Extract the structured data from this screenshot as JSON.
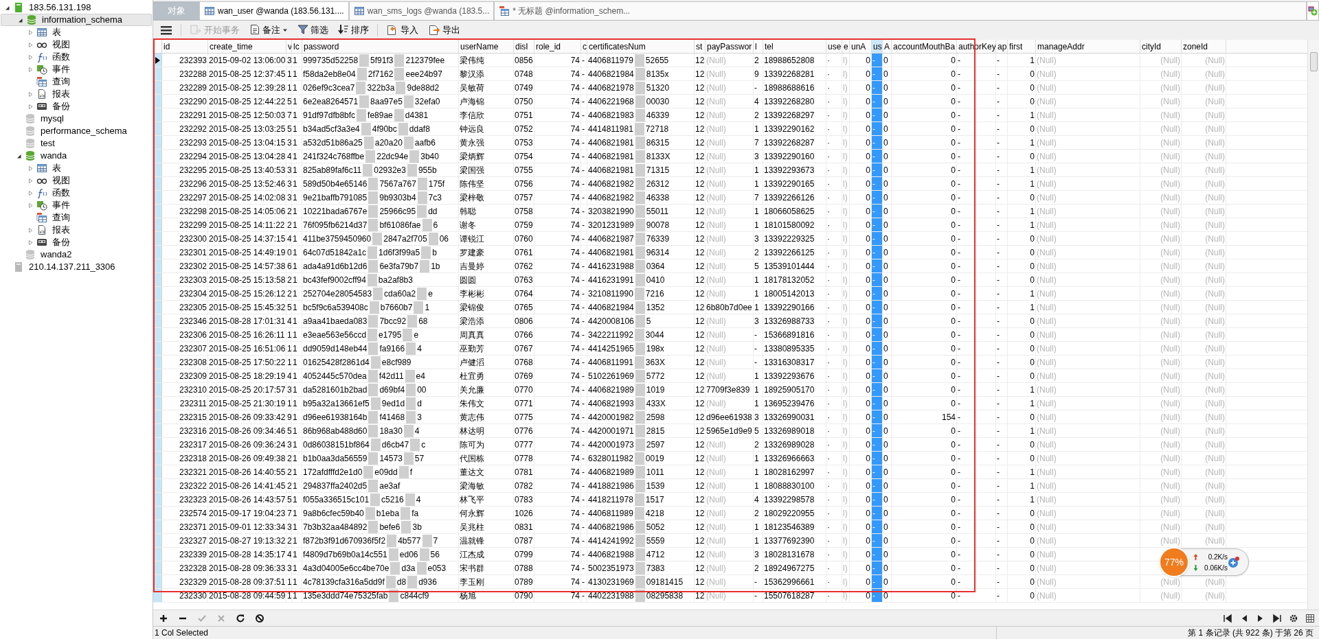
{
  "tree": [
    {
      "label": "183.56.131.198",
      "kind": "server",
      "expanded": true,
      "selected": false,
      "children": [
        {
          "label": "information_schema",
          "kind": "db",
          "expanded": true,
          "selected": true,
          "children": [
            {
              "label": "表",
              "kind": "tables",
              "expanded": false,
              "selected": false
            },
            {
              "label": "视图",
              "kind": "views",
              "expanded": false,
              "selected": false
            },
            {
              "label": "函数",
              "kind": "functions",
              "expanded": false,
              "selected": false
            },
            {
              "label": "事件",
              "kind": "events",
              "expanded": false,
              "selected": false
            },
            {
              "label": "查询",
              "kind": "queries",
              "selected": false
            },
            {
              "label": "报表",
              "kind": "reports",
              "expanded": false,
              "selected": false
            },
            {
              "label": "备份",
              "kind": "backups",
              "expanded": false,
              "selected": false
            }
          ]
        },
        {
          "label": "mysql",
          "kind": "db_off",
          "selected": false
        },
        {
          "label": "performance_schema",
          "kind": "db_off",
          "selected": false
        },
        {
          "label": "test",
          "kind": "db_off",
          "selected": false
        },
        {
          "label": "wanda",
          "kind": "db",
          "expanded": true,
          "selected": false,
          "children": [
            {
              "label": "表",
              "kind": "tables",
              "expanded": false,
              "selected": false
            },
            {
              "label": "视图",
              "kind": "views",
              "expanded": false,
              "selected": false
            },
            {
              "label": "函数",
              "kind": "functions",
              "expanded": false,
              "selected": false
            },
            {
              "label": "事件",
              "kind": "events",
              "expanded": false,
              "selected": false
            },
            {
              "label": "查询",
              "kind": "queries",
              "selected": false
            },
            {
              "label": "报表",
              "kind": "reports",
              "expanded": false,
              "selected": false
            },
            {
              "label": "备份",
              "kind": "backups",
              "expanded": false,
              "selected": false
            }
          ]
        },
        {
          "label": "wanda2",
          "kind": "db_off",
          "selected": false
        }
      ]
    },
    {
      "label": "210.14.137.211_3306",
      "kind": "server_off",
      "selected": false
    }
  ],
  "tabs": [
    {
      "label": "对象",
      "kind": "objects",
      "selected": false
    },
    {
      "label": "wan_user @wanda (183.56.131....",
      "kind": "table",
      "selected": true
    },
    {
      "label": "wan_sms_logs @wanda (183.5...",
      "kind": "table",
      "selected": false
    },
    {
      "label": "* 无标题 @information_schem...",
      "kind": "query",
      "selected": false
    }
  ],
  "toolbar": [
    {
      "kind": "menu",
      "disabled": false,
      "has_menu": false
    },
    {
      "label": "开始事务",
      "kind": "transaction",
      "disabled": true,
      "has_menu": false
    },
    {
      "label": "备注",
      "kind": "note",
      "disabled": false,
      "has_menu": true
    },
    {
      "label": "筛选",
      "kind": "filter",
      "disabled": false,
      "has_menu": false
    },
    {
      "label": "排序",
      "kind": "sort",
      "disabled": false,
      "has_menu": false
    },
    {
      "label": "导入",
      "kind": "import",
      "disabled": false,
      "has_menu": false
    },
    {
      "label": "导出",
      "kind": "export",
      "disabled": false,
      "has_menu": false
    }
  ],
  "table": {
    "columns": [
      {
        "label": "id",
        "selected": false,
        "muted": false
      },
      {
        "label": "create_time",
        "selected": false,
        "muted": false
      },
      {
        "label": "v",
        "selected": false,
        "muted": false
      },
      {
        "label": "lc",
        "selected": false,
        "muted": false
      },
      {
        "label": "password",
        "selected": false,
        "muted": false
      },
      {
        "label": "userName",
        "selected": false,
        "muted": false
      },
      {
        "label": "disI",
        "selected": false,
        "muted": false
      },
      {
        "label": "role_id",
        "selected": false,
        "muted": false
      },
      {
        "label": "c",
        "selected": false,
        "muted": false
      },
      {
        "label": "certificatesNum",
        "selected": false,
        "muted": false
      },
      {
        "label": "st",
        "selected": false,
        "muted": false
      },
      {
        "label": "payPasswor",
        "selected": false,
        "muted": false
      },
      {
        "label": "l",
        "selected": false,
        "muted": false
      },
      {
        "label": "tel",
        "selected": false,
        "muted": false
      },
      {
        "label": "use",
        "selected": false,
        "muted": false
      },
      {
        "label": "e",
        "selected": false,
        "muted": true
      },
      {
        "label": "unA",
        "selected": false,
        "muted": false
      },
      {
        "label": "us",
        "selected": true,
        "muted": false
      },
      {
        "label": "A",
        "selected": false,
        "muted": false
      },
      {
        "label": "accountMouthBa",
        "selected": false,
        "muted": false
      },
      {
        "label": "authorKey",
        "selected": false,
        "muted": false
      },
      {
        "label": "ap",
        "selected": false,
        "muted": false
      },
      {
        "label": "first",
        "selected": false,
        "muted": false
      },
      {
        "label": "manageAddr",
        "selected": false,
        "muted": true
      },
      {
        "label": "cityId",
        "selected": false,
        "muted": true
      },
      {
        "label": "zoneId",
        "selected": false,
        "muted": true
      }
    ],
    "rows": [
      {
        "current": true,
        "pay_null": true,
        "cells": [
          "232393",
          "2015-09-02 13:06:00",
          "3",
          "1",
          [
            "999735d52258",
            "5f91f3",
            "212379fee"
          ],
          "梁伟纯",
          "0856",
          "74",
          "-",
          [
            "4406811979",
            "52655"
          ],
          "12",
          "(Null)",
          "2",
          "18988652808",
          "·",
          "l)",
          "0",
          "-",
          "0",
          "0",
          "-",
          "-",
          "1",
          "(Null)",
          "(Null)",
          "(Null)"
        ]
      },
      {
        "current": false,
        "pay_null": true,
        "cells": [
          "232288",
          "2015-08-25 12:37:45",
          "1",
          "1",
          [
            "f58da2eb8e04",
            "2f7162",
            "eee24b97"
          ],
          "黎汉添",
          "0748",
          "74",
          "-",
          [
            "4406821984",
            "8135x"
          ],
          "12",
          "(Null)",
          "9",
          "13392268281",
          "·",
          "l)",
          "0",
          "-",
          "0",
          "0",
          "-",
          "-",
          "0",
          "(Null)",
          "(Null)",
          "(Null)"
        ]
      },
      {
        "current": false,
        "pay_null": true,
        "cells": [
          "232289",
          "2015-08-25 12:39:28",
          "1",
          "1",
          [
            "026ef9c3cea7",
            "322b3a",
            "9de88d2"
          ],
          "吴敏荷",
          "0749",
          "74",
          "-",
          [
            "4406821978",
            "51320"
          ],
          "12",
          "(Null)",
          "-",
          "18988688616",
          "·",
          "l)",
          "0",
          "-",
          "0",
          "0",
          "-",
          "-",
          "0",
          "(Null)",
          "(Null)",
          "(Null)"
        ]
      },
      {
        "current": false,
        "pay_null": true,
        "cells": [
          "232290",
          "2015-08-25 12:44:22",
          "5",
          "1",
          [
            "6e2ea8264571",
            "8aa97e5",
            "32efa0"
          ],
          "卢海锦",
          "0750",
          "74",
          "-",
          [
            "4406221968",
            "00030"
          ],
          "12",
          "(Null)",
          "4",
          "13392268280",
          "·",
          "l)",
          "0",
          "-",
          "0",
          "0",
          "-",
          "-",
          "0",
          "(Null)",
          "(Null)",
          "(Null)"
        ]
      },
      {
        "current": false,
        "pay_null": true,
        "cells": [
          "232291",
          "2015-08-25 12:50:03",
          "7",
          "1",
          [
            "91df97dfb8bfc",
            "fe89ae",
            "d4381"
          ],
          "李信欣",
          "0751",
          "74",
          "-",
          [
            "4406821983",
            "46339"
          ],
          "12",
          "(Null)",
          "2",
          "13392268297",
          "·",
          "l)",
          "0",
          "-",
          "0",
          "0",
          "-",
          "-",
          "1",
          "(Null)",
          "(Null)",
          "(Null)"
        ]
      },
      {
        "current": false,
        "pay_null": true,
        "cells": [
          "232292",
          "2015-08-25 13:03:25",
          "5",
          "1",
          [
            "b34ad5cf3a3e4",
            "4f90bc",
            "ddaf8"
          ],
          "钟远良",
          "0752",
          "74",
          "-",
          [
            "4414811981",
            "72718"
          ],
          "12",
          "(Null)",
          "1",
          "13392290162",
          "·",
          "l)",
          "0",
          "-",
          "0",
          "0",
          "-",
          "-",
          "0",
          "(Null)",
          "(Null)",
          "(Null)"
        ]
      },
      {
        "current": false,
        "pay_null": true,
        "cells": [
          "232293",
          "2015-08-25 13:04:15",
          "3",
          "1",
          [
            "a532d51b86a25",
            "a20a20",
            "aafb6"
          ],
          "黄永强",
          "0753",
          "74",
          "-",
          [
            "4406821981",
            "86315"
          ],
          "12",
          "(Null)",
          "7",
          "13392268287",
          "·",
          "l)",
          "0",
          "-",
          "0",
          "0",
          "-",
          "-",
          "1",
          "(Null)",
          "(Null)",
          "(Null)"
        ]
      },
      {
        "current": false,
        "pay_null": true,
        "cells": [
          "232294",
          "2015-08-25 13:04:28",
          "4",
          "1",
          [
            "241f324c768ffbe",
            "22dc94e",
            "3b40"
          ],
          "梁炳辉",
          "0754",
          "74",
          "-",
          [
            "4406821981",
            "8133X"
          ],
          "12",
          "(Null)",
          "3",
          "13392290160",
          "·",
          "l)",
          "0",
          "-",
          "0",
          "0",
          "-",
          "-",
          "0",
          "(Null)",
          "(Null)",
          "(Null)"
        ]
      },
      {
        "current": false,
        "pay_null": true,
        "cells": [
          "232295",
          "2015-08-25 13:40:53",
          "3",
          "1",
          [
            "825ab89faf6c11",
            "02932e3",
            "955b"
          ],
          "梁国强",
          "0755",
          "74",
          "-",
          [
            "4406821981",
            "71315"
          ],
          "12",
          "(Null)",
          "1",
          "13392293673",
          "·",
          "l)",
          "0",
          "-",
          "0",
          "0",
          "-",
          "-",
          "1",
          "(Null)",
          "(Null)",
          "(Null)"
        ]
      },
      {
        "current": false,
        "pay_null": true,
        "cells": [
          "232296",
          "2015-08-25 13:52:46",
          "3",
          "1",
          [
            "589d50b4e65146",
            "7567a767",
            "175f"
          ],
          "陈伟坚",
          "0756",
          "74",
          "-",
          [
            "4406821982",
            "26312"
          ],
          "12",
          "(Null)",
          "1",
          "13392290165",
          "·",
          "l)",
          "0",
          "-",
          "0",
          "0",
          "-",
          "-",
          "1",
          "(Null)",
          "(Null)",
          "(Null)"
        ]
      },
      {
        "current": false,
        "pay_null": true,
        "cells": [
          "232297",
          "2015-08-25 14:02:08",
          "3",
          "1",
          [
            "9e21baffb791085",
            "9b9303b4",
            "7c3"
          ],
          "梁梓敬",
          "0757",
          "74",
          "-",
          [
            "4406821982",
            "46338"
          ],
          "12",
          "(Null)",
          "7",
          "13392266126",
          "·",
          "l)",
          "0",
          "-",
          "0",
          "0",
          "-",
          "-",
          "0",
          "(Null)",
          "(Null)",
          "(Null)"
        ]
      },
      {
        "current": false,
        "pay_null": true,
        "cells": [
          "232298",
          "2015-08-25 14:05:06",
          "2",
          "1",
          [
            "10221bada6767e",
            "25966c95",
            "dd"
          ],
          "韩聪",
          "0758",
          "74",
          "-",
          [
            "3203821990",
            "55011"
          ],
          "12",
          "(Null)",
          "1",
          "18066058625",
          "·",
          "l)",
          "0",
          "-",
          "0",
          "0",
          "-",
          "-",
          "1",
          "(Null)",
          "(Null)",
          "(Null)"
        ]
      },
      {
        "current": false,
        "pay_null": true,
        "cells": [
          "232299",
          "2015-08-25 14:11:22",
          "2",
          "1",
          [
            "76f095fb6214d37",
            "bf61086fae",
            "6"
          ],
          "谢冬",
          "0759",
          "74",
          "-",
          [
            "3201231989",
            "90078"
          ],
          "12",
          "(Null)",
          "1",
          "18101580092",
          "·",
          "l)",
          "0",
          "-",
          "0",
          "0",
          "-",
          "-",
          "1",
          "(Null)",
          "(Null)",
          "(Null)"
        ]
      },
      {
        "current": false,
        "pay_null": true,
        "cells": [
          "232300",
          "2015-08-25 14:37:15",
          "4",
          "1",
          [
            "411be3759450960",
            "2847a2f705",
            "06"
          ],
          "谭锐江",
          "0760",
          "74",
          "-",
          [
            "4406821987",
            "76339"
          ],
          "12",
          "(Null)",
          "3",
          "13392229325",
          "·",
          "l)",
          "0",
          "-",
          "0",
          "0",
          "-",
          "-",
          "0",
          "(Null)",
          "(Null)",
          "(Null)"
        ]
      },
      {
        "current": false,
        "pay_null": true,
        "cells": [
          "232301",
          "2015-08-25 14:49:19",
          "0",
          "1",
          [
            "64c07d51842a1c",
            "1d6f3f99a5",
            "b"
          ],
          "罗建豪",
          "0761",
          "74",
          "-",
          [
            "4406821981",
            "96314"
          ],
          "12",
          "(Null)",
          "2",
          "13392266125",
          "·",
          "l)",
          "0",
          "-",
          "0",
          "0",
          "-",
          "-",
          "0",
          "(Null)",
          "(Null)",
          "(Null)"
        ]
      },
      {
        "current": false,
        "pay_null": true,
        "cells": [
          "232302",
          "2015-08-25 14:57:38",
          "6",
          "1",
          [
            "ada4a91d6b12d6",
            "6e3fa79b7",
            "1b"
          ],
          "吉曼婷",
          "0762",
          "74",
          "-",
          [
            "4416231988",
            "0364"
          ],
          "12",
          "(Null)",
          "5",
          "13539101444",
          "·",
          "l)",
          "0",
          "-",
          "0",
          "0",
          "-",
          "-",
          "0",
          "(Null)",
          "(Null)",
          "(Null)"
        ]
      },
      {
        "current": false,
        "pay_null": true,
        "cells": [
          "232303",
          "2015-08-25 15:13:58",
          "2",
          "1",
          [
            "bc43fef9002cff94",
            "ba2af8b3"
          ],
          "圆圆",
          "0763",
          "74",
          "-",
          [
            "4416231991",
            "0410"
          ],
          "12",
          "(Null)",
          "1",
          "18178132052",
          "·",
          "l)",
          "0",
          "-",
          "0",
          "0",
          "-",
          "-",
          "0",
          "(Null)",
          "(Null)",
          "(Null)"
        ]
      },
      {
        "current": false,
        "pay_null": true,
        "cells": [
          "232304",
          "2015-08-25 15:26:12",
          "2",
          "1",
          [
            "252704e28054583",
            "cda60a2",
            "e"
          ],
          "李彬彬",
          "0764",
          "74",
          "-",
          [
            "3210811990",
            "7216"
          ],
          "12",
          "(Null)",
          "1",
          "18005142013",
          "·",
          "l)",
          "0",
          "-",
          "0",
          "0",
          "-",
          "-",
          "1",
          "(Null)",
          "(Null)",
          "(Null)"
        ]
      },
      {
        "current": false,
        "pay_null": false,
        "cells": [
          "232305",
          "2015-08-25 15:45:32",
          "5",
          "1",
          [
            "bc5f9c6a539408c",
            "b7660b7",
            "1"
          ],
          "梁锦俊",
          "0765",
          "74",
          "-",
          [
            "4406821984",
            "1352"
          ],
          "12",
          "6b80b7d0ee",
          "1",
          "13392290166",
          "·",
          "l)",
          "0",
          "-",
          "0",
          "0",
          "-",
          "-",
          "1",
          "(Null)",
          "(Null)",
          "(Null)"
        ]
      },
      {
        "current": false,
        "pay_null": true,
        "cells": [
          "232346",
          "2015-08-28 17:01:31",
          "4",
          "1",
          [
            "a9aa41baeda083",
            "7bcc92",
            "68"
          ],
          "梁浩添",
          "0806",
          "74",
          "-",
          [
            "4420008106",
            "5"
          ],
          "12",
          "(Null)",
          "3",
          "13326988733",
          "·",
          "l)",
          "0",
          "-",
          "0",
          "0",
          "-",
          "-",
          "0",
          "(Null)",
          "(Null)",
          "(Null)"
        ]
      },
      {
        "current": false,
        "pay_null": true,
        "cells": [
          "232306",
          "2015-08-25 16:26:11",
          "1",
          "1",
          [
            "e3eae563e56ccd",
            "e1795",
            "e"
          ],
          "周真真",
          "0766",
          "74",
          "-",
          [
            "3422211992",
            "3044"
          ],
          "12",
          "(Null)",
          "-",
          "15366891816",
          "·",
          "l)",
          "0",
          "-",
          "0",
          "0",
          "-",
          "-",
          "0",
          "(Null)",
          "(Null)",
          "(Null)"
        ]
      },
      {
        "current": false,
        "pay_null": true,
        "cells": [
          "232307",
          "2015-08-25 16:51:06",
          "1",
          "1",
          [
            "dd9059d148eb44",
            "fa9166",
            "4"
          ],
          "巫勤芳",
          "0767",
          "74",
          "-",
          [
            "4414251965",
            "198x"
          ],
          "12",
          "(Null)",
          "-",
          "13380895335",
          "·",
          "l)",
          "0",
          "-",
          "0",
          "0",
          "-",
          "-",
          "0",
          "(Null)",
          "(Null)",
          "(Null)"
        ]
      },
      {
        "current": false,
        "pay_null": true,
        "cells": [
          "232308",
          "2015-08-25 17:50:22",
          "1",
          "1",
          [
            "01625428f2861d4",
            "e8cf989"
          ],
          "卢健滔",
          "0768",
          "74",
          "-",
          [
            "4406811991",
            "363X"
          ],
          "12",
          "(Null)",
          "-",
          "13316308317",
          "·",
          "l)",
          "0",
          "-",
          "0",
          "0",
          "-",
          "-",
          "0",
          "(Null)",
          "(Null)",
          "(Null)"
        ]
      },
      {
        "current": false,
        "pay_null": true,
        "cells": [
          "232309",
          "2015-08-25 18:29:19",
          "4",
          "1",
          [
            "4052445c570dea",
            "f42d11",
            "e4"
          ],
          "杜宜勇",
          "0769",
          "74",
          "-",
          [
            "5102261969",
            "5772"
          ],
          "12",
          "(Null)",
          "1",
          "13392293676",
          "·",
          "l)",
          "0",
          "-",
          "0",
          "0",
          "-",
          "-",
          "0",
          "(Null)",
          "(Null)",
          "(Null)"
        ]
      },
      {
        "current": false,
        "pay_null": false,
        "cells": [
          "232310",
          "2015-08-25 20:17:57",
          "3",
          "1",
          [
            "da5281601b2bad",
            "d69bf4",
            "00"
          ],
          "关允廉",
          "0770",
          "74",
          "-",
          [
            "4406821989",
            "1019"
          ],
          "12",
          "7709f3e839",
          "1",
          "18925905170",
          "·",
          "l)",
          "0",
          "-",
          "0",
          "0",
          "-",
          "-",
          "1",
          "(Null)",
          "(Null)",
          "(Null)"
        ]
      },
      {
        "current": false,
        "pay_null": true,
        "cells": [
          "232311",
          "2015-08-25 21:30:19",
          "1",
          "1",
          [
            "b95a32a13661ef5",
            "9ed1d",
            "d"
          ],
          "朱伟文",
          "0771",
          "74",
          "-",
          [
            "4406821993",
            "433X"
          ],
          "12",
          "(Null)",
          "1",
          "13695239476",
          "·",
          "l)",
          "0",
          "-",
          "0",
          "0",
          "-",
          "-",
          "1",
          "(Null)",
          "(Null)",
          "(Null)"
        ]
      },
      {
        "current": false,
        "pay_null": false,
        "cells": [
          "232315",
          "2015-08-26 09:33:42",
          "9",
          "1",
          [
            "d96ee61938164b",
            "f41468",
            "3"
          ],
          "黄志伟",
          "0775",
          "74",
          "-",
          [
            "4420001982",
            "2598"
          ],
          "12",
          "d96ee61938",
          "3",
          "13326990031",
          "·",
          "l)",
          "0",
          "-",
          "0",
          "154",
          "-",
          "-",
          "0",
          "(Null)",
          "(Null)",
          "(Null)"
        ]
      },
      {
        "current": false,
        "pay_null": false,
        "cells": [
          "232316",
          "2015-08-26 09:34:46",
          "5",
          "1",
          [
            "86b968ab488d60",
            "18a30",
            "4"
          ],
          "林达明",
          "0776",
          "74",
          "-",
          [
            "4420001971",
            "2815"
          ],
          "12",
          "5965e1d9e9",
          "5",
          "13326989018",
          "·",
          "l)",
          "0",
          "-",
          "0",
          "0",
          "-",
          "-",
          "1",
          "(Null)",
          "(Null)",
          "(Null)"
        ]
      },
      {
        "current": false,
        "pay_null": true,
        "cells": [
          "232317",
          "2015-08-26 09:36:24",
          "3",
          "1",
          [
            "0d86038151bf864",
            "d6cb47",
            "c"
          ],
          "陈可为",
          "0777",
          "74",
          "-",
          [
            "4420001973",
            "2597"
          ],
          "12",
          "(Null)",
          "2",
          "13326989028",
          "·",
          "l)",
          "0",
          "-",
          "0",
          "0",
          "-",
          "-",
          "0",
          "(Null)",
          "(Null)",
          "(Null)"
        ]
      },
      {
        "current": false,
        "pay_null": true,
        "cells": [
          "232318",
          "2015-08-26 09:49:38",
          "2",
          "1",
          [
            "b1b0aa3da56559",
            "14573",
            "57"
          ],
          "代国栋",
          "0778",
          "74",
          "-",
          [
            "6328011982",
            "0019"
          ],
          "12",
          "(Null)",
          "1",
          "13326966663",
          "·",
          "l)",
          "0",
          "-",
          "0",
          "0",
          "-",
          "-",
          "0",
          "(Null)",
          "(Null)",
          "(Null)"
        ]
      },
      {
        "current": false,
        "pay_null": true,
        "cells": [
          "232321",
          "2015-08-26 14:40:55",
          "2",
          "1",
          [
            "172afdfffd2e1d0",
            "e09dd",
            "f"
          ],
          "董达文",
          "0781",
          "74",
          "-",
          [
            "4406821989",
            "1011"
          ],
          "12",
          "(Null)",
          "1",
          "18028162997",
          "·",
          "l)",
          "0",
          "-",
          "0",
          "0",
          "-",
          "-",
          "1",
          "(Null)",
          "(Null)",
          "(Null)"
        ]
      },
      {
        "current": false,
        "pay_null": true,
        "cells": [
          "232322",
          "2015-08-26 14:41:45",
          "2",
          "1",
          [
            "294837ffa2402d5",
            "ae3af"
          ],
          "梁海敏",
          "0782",
          "74",
          "-",
          [
            "4418821986",
            "1539"
          ],
          "12",
          "(Null)",
          "1",
          "18088830100",
          "·",
          "l)",
          "0",
          "-",
          "0",
          "0",
          "-",
          "-",
          "1",
          "(Null)",
          "(Null)",
          "(Null)"
        ]
      },
      {
        "current": false,
        "pay_null": true,
        "cells": [
          "232323",
          "2015-08-26 14:43:57",
          "5",
          "1",
          [
            "f055a336515c101",
            "c5216",
            "4"
          ],
          "林飞平",
          "0783",
          "74",
          "-",
          [
            "4418211978",
            "1517"
          ],
          "12",
          "(Null)",
          "4",
          "13392298578",
          "·",
          "l)",
          "0",
          "-",
          "0",
          "0",
          "-",
          "-",
          "1",
          "(Null)",
          "(Null)",
          "(Null)"
        ]
      },
      {
        "current": false,
        "pay_null": true,
        "cells": [
          "232574",
          "2015-09-17 19:04:23",
          "7",
          "1",
          [
            "9a8b6cfec59b40",
            "b1eba",
            "fa"
          ],
          "何永辉",
          "1026",
          "74",
          "-",
          [
            "4406811989",
            "4218"
          ],
          "12",
          "(Null)",
          "2",
          "18029220955",
          "·",
          "l)",
          "0",
          "-",
          "0",
          "0",
          "-",
          "-",
          "0",
          "(Null)",
          "(Null)",
          "(Null)"
        ]
      },
      {
        "current": false,
        "pay_null": true,
        "cells": [
          "232371",
          "2015-09-01 12:33:34",
          "3",
          "1",
          [
            "7b3b32aa484892",
            "befe6",
            "3b"
          ],
          "吴兆柱",
          "0831",
          "74",
          "-",
          [
            "4406821986",
            "5052"
          ],
          "12",
          "(Null)",
          "1",
          "18123546389",
          "·",
          "l)",
          "0",
          "-",
          "0",
          "0",
          "-",
          "-",
          "0",
          "(Null)",
          "(Null)",
          "(Null)"
        ]
      },
      {
        "current": false,
        "pay_null": true,
        "cells": [
          "232327",
          "2015-08-27 19:13:32",
          "2",
          "1",
          [
            "f872b3f91d670936f5f2",
            "4b577",
            "7"
          ],
          "温就锋",
          "0787",
          "74",
          "-",
          [
            "4414241992",
            "5559"
          ],
          "12",
          "(Null)",
          "1",
          "13377692390",
          "·",
          "l)",
          "0",
          "-",
          "0",
          "0",
          "-",
          "-",
          "0",
          "(Null)",
          "(Null)",
          "(Null)"
        ]
      },
      {
        "current": false,
        "pay_null": true,
        "cells": [
          "232339",
          "2015-08-28 14:35:17",
          "4",
          "1",
          [
            "f4809d7b69b0a14c551",
            "ed06",
            "56"
          ],
          "江杰成",
          "0799",
          "74",
          "-",
          [
            "4406821988",
            "4712"
          ],
          "12",
          "(Null)",
          "3",
          "18028131678",
          "·",
          "l)",
          "0",
          "-",
          "0",
          "0",
          "-",
          "-",
          "0",
          "(Null)"
        ]
      },
      {
        "current": false,
        "pay_null": true,
        "cells": [
          "232328",
          "2015-08-28 09:36:33",
          "3",
          "1",
          [
            "4a3d04005e6cc4be70e",
            "d3a",
            "e053"
          ],
          "宋书群",
          "0788",
          "74",
          "-",
          [
            "5002351973",
            "7383"
          ],
          "12",
          "(Null)",
          "2",
          "18924967275",
          "·",
          "l)",
          "0",
          "-",
          "0",
          "0",
          "-",
          "-",
          "0",
          "(Null)"
        ]
      },
      {
        "current": false,
        "pay_null": true,
        "cells": [
          "232329",
          "2015-08-28 09:37:51",
          "1",
          "1",
          [
            "4c78139cfa316a5dd9f",
            "d8",
            "d936"
          ],
          "李玉刚",
          "0789",
          "74",
          "-",
          [
            "4130231969",
            "09181415"
          ],
          "12",
          "(Null)",
          "-",
          "15362996661",
          "·",
          "l)",
          "0",
          "-",
          "0",
          "0",
          "-",
          "-",
          "0",
          "(Null)",
          "(Null)",
          "(Null)"
        ]
      },
      {
        "current": false,
        "pay_null": true,
        "cells": [
          "232330",
          "2015-08-28 09:44:59",
          "1",
          "1",
          [
            "135e3ddd74e75325fab",
            "c844cf9"
          ],
          "杨旭",
          "0790",
          "74",
          "-",
          [
            "4402231988",
            "08295838"
          ],
          "12",
          "(Null)",
          "-",
          "15507618287",
          "·",
          "l)",
          "0",
          "-",
          "0",
          "0",
          "-",
          "-",
          "0",
          "(Null)",
          "(Null)",
          "(Null)"
        ]
      }
    ]
  },
  "edit_buttons": [
    {
      "kind": "add",
      "disabled": false
    },
    {
      "kind": "remove",
      "disabled": false
    },
    {
      "kind": "apply",
      "disabled": true
    },
    {
      "kind": "cancel",
      "disabled": true
    },
    {
      "kind": "refresh",
      "disabled": false
    },
    {
      "kind": "stop",
      "disabled": false
    }
  ],
  "pager": [
    {
      "kind": "first"
    },
    {
      "kind": "prev"
    },
    {
      "kind": "next"
    },
    {
      "kind": "last"
    },
    {
      "kind": "settings"
    },
    {
      "kind": "grid"
    }
  ],
  "status_bar": {
    "selection": "1 Col Selected",
    "record_info": "第 1 条记录 (共 922 条) 于第 26 页"
  },
  "net_widget": {
    "percent": "77%",
    "up": "0.2K/s",
    "down": "0.06K/s"
  }
}
